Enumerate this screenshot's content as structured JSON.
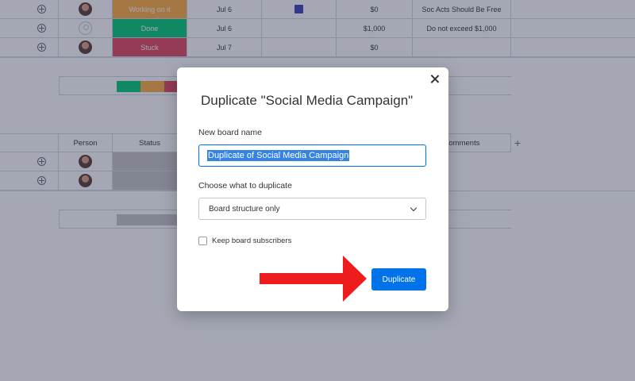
{
  "board": {
    "rows": [
      {
        "status": "Working on it",
        "status_color": "#fdab3d",
        "date": "Jul 6",
        "has_file": true,
        "number": "$0",
        "text": "Soc Acts Should Be Free",
        "avatar": "photo"
      },
      {
        "status": "Done",
        "status_color": "#00c875",
        "date": "Jul 6",
        "has_file": false,
        "number": "$1,000",
        "text": "Do not exceed $1,000",
        "avatar": "empty"
      },
      {
        "status": "Stuck",
        "status_color": "#e2445c",
        "date": "Jul 7",
        "has_file": false,
        "number": "$0",
        "text": "",
        "avatar": "photo"
      }
    ],
    "summary_colors": [
      "#00c875",
      "#fdab3d",
      "#e2445c"
    ],
    "group2_headers": {
      "person": "Person",
      "status": "Status",
      "comments": "Comments",
      "add_column": "+"
    },
    "group2_summary_color": "#c4c4c4"
  },
  "modal": {
    "title": "Duplicate \"Social Media Campaign\"",
    "name_label": "New board name",
    "name_value": "Duplicate of Social Media Campaign",
    "choose_label": "Choose what to duplicate",
    "choose_value": "Board structure only",
    "checkbox_label": "Keep board subscribers",
    "checkbox_checked": false,
    "duplicate_button": "Duplicate"
  },
  "annotation": {
    "arrow_color": "#ee1c1c",
    "arrow_target": "duplicate-button"
  }
}
